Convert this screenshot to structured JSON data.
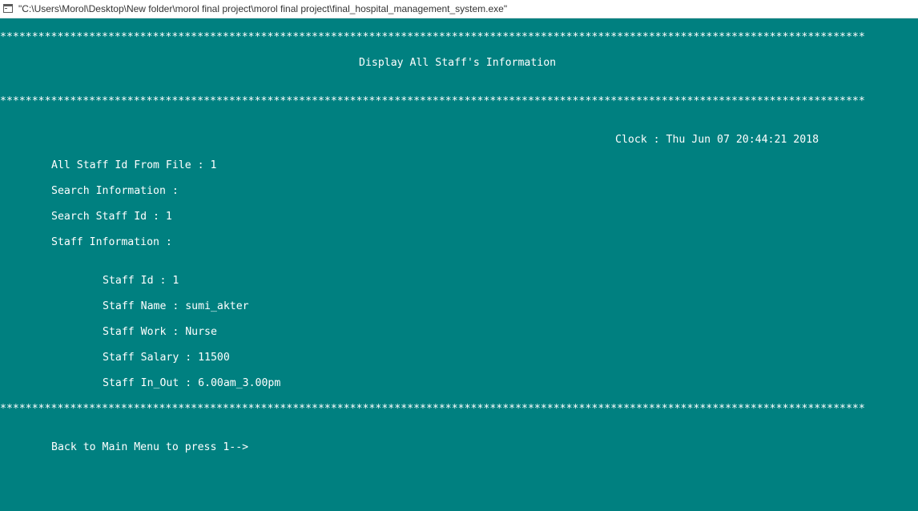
{
  "window": {
    "title": "\"C:\\Users\\Morol\\Desktop\\New folder\\morol final project\\morol final project\\final_hospital_management_system.exe\"",
    "icon": "console-window-icon"
  },
  "console": {
    "separator": "****************************************************************************************************************************************",
    "heading": "Display All Staff's Information",
    "clock": "Clock : Thu Jun 07 20:44:21 2018",
    "all_staff_id_line": "All Staff Id From File : 1",
    "search_information_label": "Search Information :",
    "search_staff_id_line": "Search Staff Id : 1",
    "staff_information_label": "Staff Information :",
    "staff": {
      "id_line": "Staff Id : 1",
      "name_line": "Staff Name : sumi_akter",
      "work_line": "Staff Work : Nurse",
      "salary_line": "Staff Salary : 11500",
      "in_out_line": "Staff In_Out : 6.00am_3.00pm"
    },
    "prompt": "Back to Main Menu to press 1-->"
  },
  "colors": {
    "console_background": "#008080",
    "console_text": "#ffffff",
    "titlebar_background": "#ffffff"
  }
}
